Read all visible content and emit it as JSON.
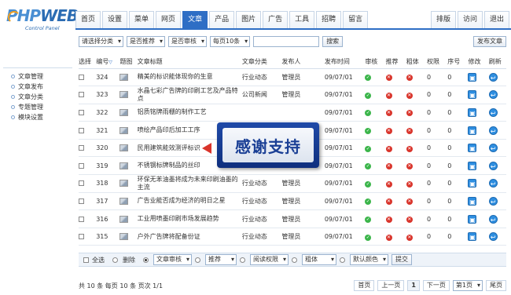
{
  "logo": {
    "mark_a": "PHP",
    "mark_b": "WEB",
    "sub": "Control Panel"
  },
  "topnav": {
    "tabs": [
      "首页",
      "设置",
      "菜单",
      "网页",
      "文章",
      "产品",
      "图片",
      "广告",
      "工具",
      "招聘",
      "留言"
    ],
    "active_index": 4,
    "right": [
      "排版",
      "访问",
      "退出"
    ]
  },
  "sidebar": {
    "items": [
      "文章管理",
      "文章发布",
      "文章分类",
      "专题管理",
      "模块设置"
    ]
  },
  "filters": {
    "category": "请选择分类",
    "recommend": "是否推荐",
    "audit": "是否审核",
    "per_page": "每页10条",
    "search_placeholder": "",
    "search_label": "搜索",
    "publish_label": "发布文章"
  },
  "table": {
    "headers": [
      "选择",
      "编号",
      "题图",
      "文章标题",
      "文章分类",
      "发布人",
      "发布时间",
      "审核",
      "推荐",
      "粗体",
      "权限",
      "序号",
      "修改",
      "刷新"
    ],
    "rows": [
      {
        "id": "324",
        "title": "精美的标识能体现你的生意",
        "category": "行业动态",
        "author": "管理员",
        "date": "09/07/01",
        "audit": true,
        "recommend": false,
        "bold": false,
        "perm": "0",
        "order": "0"
      },
      {
        "id": "323",
        "title": "水晶七彩广告牌的印刷工艺及产品特点",
        "category": "公司新闻",
        "author": "管理员",
        "date": "09/07/01",
        "audit": true,
        "recommend": false,
        "bold": false,
        "perm": "0",
        "order": "0"
      },
      {
        "id": "322",
        "title": "铝质铭牌雨棚的制作工艺",
        "category": "",
        "author": "",
        "date": "09/07/01",
        "audit": true,
        "recommend": false,
        "bold": false,
        "perm": "0",
        "order": "0"
      },
      {
        "id": "321",
        "title": "喷绘产品印后加工工序",
        "category": "",
        "author": "",
        "date": "09/07/01",
        "audit": true,
        "recommend": false,
        "bold": false,
        "perm": "0",
        "order": "0"
      },
      {
        "id": "320",
        "title": "民用建筑能效测评标识",
        "category": "",
        "author": "",
        "date": "09/07/01",
        "audit": true,
        "recommend": false,
        "bold": false,
        "perm": "0",
        "order": "0"
      },
      {
        "id": "319",
        "title": "不锈钢标牌制品的丝印",
        "category": "",
        "author": "",
        "date": "09/07/01",
        "audit": true,
        "recommend": false,
        "bold": false,
        "perm": "0",
        "order": "0"
      },
      {
        "id": "318",
        "title": "环保无苯油墨将成为未来印刷油墨的主流",
        "category": "行业动态",
        "author": "管理员",
        "date": "09/07/01",
        "audit": true,
        "recommend": false,
        "bold": false,
        "perm": "0",
        "order": "0"
      },
      {
        "id": "317",
        "title": "广告业能否成为经济的明日之星",
        "category": "行业动态",
        "author": "管理员",
        "date": "09/07/01",
        "audit": true,
        "recommend": false,
        "bold": false,
        "perm": "0",
        "order": "0"
      },
      {
        "id": "316",
        "title": "工业用喷墨印刷市场发展趋势",
        "category": "行业动态",
        "author": "管理员",
        "date": "09/07/01",
        "audit": true,
        "recommend": false,
        "bold": false,
        "perm": "0",
        "order": "0"
      },
      {
        "id": "315",
        "title": "户外广告牌将配备份证",
        "category": "行业动态",
        "author": "管理员",
        "date": "09/07/01",
        "audit": true,
        "recommend": false,
        "bold": false,
        "perm": "0",
        "order": "0"
      }
    ]
  },
  "overlay": {
    "text": "感谢支持"
  },
  "actions": {
    "select_all": "全选",
    "delete": "删除",
    "audit_sel": "文章审核",
    "recommend_sel": "推荐",
    "perm_sel": "阅读权限",
    "bold_sel": "粗体",
    "color_sel": "默认颜色",
    "submit": "提交"
  },
  "pager": {
    "info": "共 10 条 每页 10 条 页次 1/1",
    "first": "首页",
    "prev": "上一页",
    "current": "1",
    "next": "下一页",
    "page_select": "第1页",
    "last": "尾页"
  }
}
